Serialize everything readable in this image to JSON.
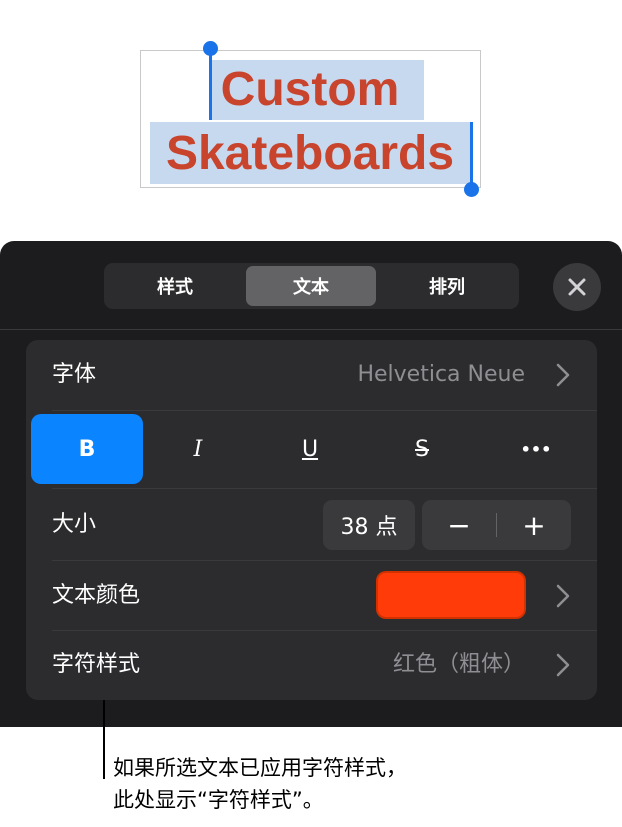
{
  "canvas": {
    "selected_text": [
      "Custom",
      "Skateboards"
    ],
    "text_color": "#c8442c",
    "selection_color": "#c7d9ee"
  },
  "panel": {
    "tabs": [
      {
        "label": "样式",
        "active": false
      },
      {
        "label": "文本",
        "active": true
      },
      {
        "label": "排列",
        "active": false
      }
    ],
    "close_icon": "xmark",
    "font": {
      "label": "字体",
      "value": "Helvetica Neue"
    },
    "styles": [
      {
        "label": "B",
        "name": "bold",
        "active": true
      },
      {
        "label": "I",
        "name": "italic",
        "active": false
      },
      {
        "label": "U",
        "name": "underline",
        "active": false
      },
      {
        "label": "S",
        "name": "strikethrough",
        "active": false
      },
      {
        "label": "•••",
        "name": "more",
        "active": false
      }
    ],
    "size": {
      "label": "大小",
      "value": "38 点",
      "decrement": "−",
      "increment": "+"
    },
    "text_color": {
      "label": "文本颜色",
      "swatch": "#ff3b0a"
    },
    "char_style": {
      "label": "字符样式",
      "value": "红色（粗体）"
    }
  },
  "callout": {
    "line1": "如果所选文本已应用字符样式，",
    "line2": "此处显示“字符样式”。"
  }
}
